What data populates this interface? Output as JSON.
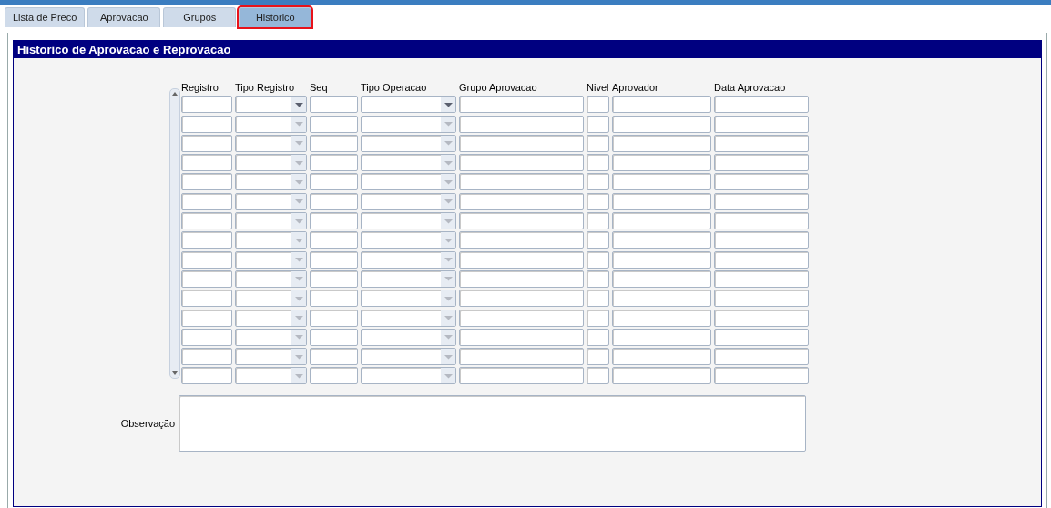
{
  "tabs": [
    {
      "label": "Lista de Preco",
      "selected": false,
      "highlighted": false
    },
    {
      "label": "Aprovacao",
      "selected": false,
      "highlighted": false
    },
    {
      "label": "Grupos",
      "selected": false,
      "highlighted": false
    },
    {
      "label": "Historico",
      "selected": true,
      "highlighted": true
    }
  ],
  "section_title": "Historico de Aprovacao e Reprovacao",
  "table": {
    "columns": [
      {
        "label": "Registro",
        "kind": "text"
      },
      {
        "label": "Tipo Registro",
        "kind": "combo"
      },
      {
        "label": "Seq",
        "kind": "text"
      },
      {
        "label": "Tipo Operacao",
        "kind": "combo"
      },
      {
        "label": "Grupo Aprovacao",
        "kind": "text"
      },
      {
        "label": "Nivel",
        "kind": "text"
      },
      {
        "label": "Aprovador",
        "kind": "text"
      },
      {
        "label": "Data Aprovacao",
        "kind": "text"
      }
    ],
    "rows": [
      {
        "current": true
      },
      {
        "current": false
      },
      {
        "current": false
      },
      {
        "current": false
      },
      {
        "current": false
      },
      {
        "current": false
      },
      {
        "current": false
      },
      {
        "current": false
      },
      {
        "current": false
      },
      {
        "current": false
      },
      {
        "current": false
      },
      {
        "current": false
      },
      {
        "current": false
      },
      {
        "current": false
      },
      {
        "current": false
      }
    ]
  },
  "observation": {
    "label": "Observação"
  }
}
